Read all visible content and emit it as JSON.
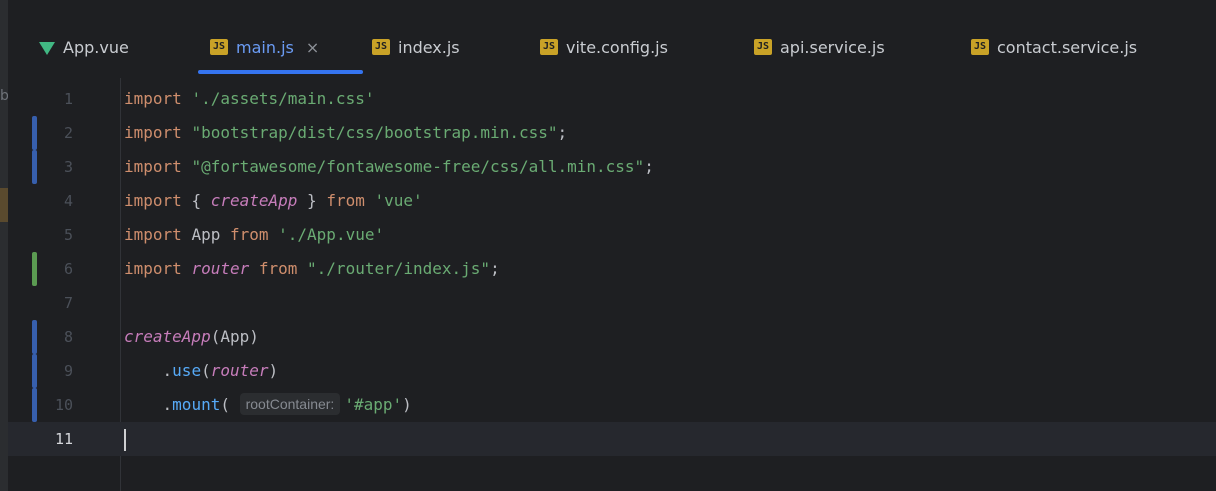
{
  "tabs": [
    {
      "label": "App.vue",
      "icon": "vue-icon",
      "active": false
    },
    {
      "label": "main.js",
      "icon": "js-icon",
      "active": true,
      "close": "×"
    },
    {
      "label": "index.js",
      "icon": "js-icon",
      "active": false
    },
    {
      "label": "vite.config.js",
      "icon": "js-icon",
      "active": false
    },
    {
      "label": "api.service.js",
      "icon": "js-icon",
      "active": false
    },
    {
      "label": "contact.service.js",
      "icon": "js-icon",
      "active": false
    }
  ],
  "js_icon_text": "JS",
  "strip_glyph": "b",
  "lines": [
    {
      "n": "1",
      "change": "",
      "tokens": [
        {
          "t": "import ",
          "c": "kw"
        },
        {
          "t": "'./assets/main.css'",
          "c": "str"
        }
      ]
    },
    {
      "n": "2",
      "change": "modified",
      "tokens": [
        {
          "t": "import ",
          "c": "kw"
        },
        {
          "t": "\"bootstrap/dist/css/bootstrap.min.css\"",
          "c": "str"
        },
        {
          "t": ";",
          "c": "plain"
        }
      ]
    },
    {
      "n": "3",
      "change": "modified",
      "tokens": [
        {
          "t": "import ",
          "c": "kw"
        },
        {
          "t": "\"@fortawesome/fontawesome-free/css/all.min.css\"",
          "c": "str"
        },
        {
          "t": ";",
          "c": "plain"
        }
      ]
    },
    {
      "n": "4",
      "change": "",
      "tokens": [
        {
          "t": "import ",
          "c": "kw"
        },
        {
          "t": "{ ",
          "c": "plain"
        },
        {
          "t": "createApp",
          "c": "fn-italic"
        },
        {
          "t": " } ",
          "c": "plain"
        },
        {
          "t": "from ",
          "c": "kw"
        },
        {
          "t": "'vue'",
          "c": "str"
        }
      ]
    },
    {
      "n": "5",
      "change": "",
      "tokens": [
        {
          "t": "import ",
          "c": "kw"
        },
        {
          "t": "App ",
          "c": "plain"
        },
        {
          "t": "from ",
          "c": "kw"
        },
        {
          "t": "'./App.vue'",
          "c": "str"
        }
      ]
    },
    {
      "n": "6",
      "change": "added",
      "tokens": [
        {
          "t": "import ",
          "c": "kw"
        },
        {
          "t": "router",
          "c": "fn-italic"
        },
        {
          "t": " from ",
          "c": "kw"
        },
        {
          "t": "\"./router/index.js\"",
          "c": "str"
        },
        {
          "t": ";",
          "c": "plain"
        }
      ]
    },
    {
      "n": "7",
      "change": "",
      "tokens": []
    },
    {
      "n": "8",
      "change": "modified",
      "tokens": [
        {
          "t": "createApp",
          "c": "fn-italic"
        },
        {
          "t": "(App)",
          "c": "plain"
        }
      ]
    },
    {
      "n": "9",
      "change": "modified",
      "tokens": [
        {
          "t": "    .",
          "c": "plain"
        },
        {
          "t": "use",
          "c": "method"
        },
        {
          "t": "(",
          "c": "plain"
        },
        {
          "t": "router",
          "c": "fn-italic"
        },
        {
          "t": ")",
          "c": "plain"
        }
      ]
    },
    {
      "n": "10",
      "change": "modified",
      "tokens": [
        {
          "t": "    .",
          "c": "plain"
        },
        {
          "t": "mount",
          "c": "method"
        },
        {
          "t": "( ",
          "c": "plain"
        },
        {
          "t": "rootContainer:",
          "c": "hint"
        },
        {
          "t": "'#app'",
          "c": "str"
        },
        {
          "t": ")",
          "c": "plain"
        }
      ]
    },
    {
      "n": "11",
      "change": "",
      "current": true,
      "caret": true,
      "tokens": []
    }
  ],
  "colors": {
    "background": "#1e1f22",
    "active_tab": "#6b9cf5",
    "keyword": "#cf8e6d",
    "string": "#6aab73",
    "function": "#c77dbb",
    "method": "#57aaf7",
    "modified_bar": "#375fad",
    "added_bar": "#5b9b52"
  }
}
